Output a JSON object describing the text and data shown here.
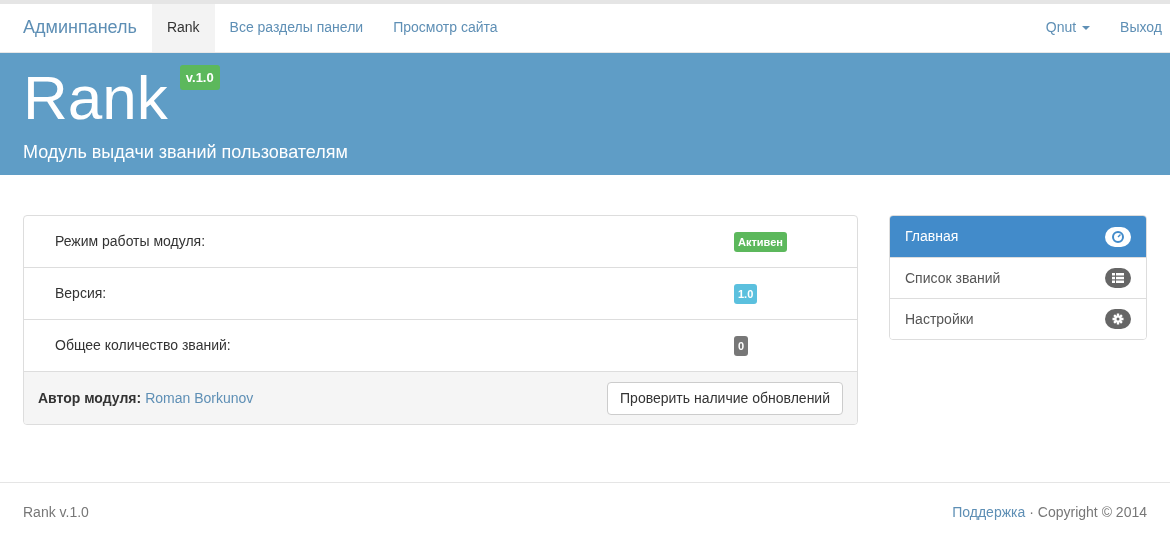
{
  "navbar": {
    "brand": "Админпанель",
    "items": [
      {
        "label": "Rank",
        "selected": true
      },
      {
        "label": "Все разделы панели",
        "selected": false
      },
      {
        "label": "Просмотр сайта",
        "selected": false
      }
    ],
    "user": "Qnut",
    "logout": "Выход"
  },
  "header": {
    "title": "Rank",
    "version": "v.1.0",
    "subtitle": "Модуль выдачи званий пользователям"
  },
  "info_rows": [
    {
      "label": "Режим работы модуля:",
      "badge": "Активен",
      "color": "#5cb85c"
    },
    {
      "label": "Версия:",
      "badge": "1.0",
      "color": "#5bc0de"
    },
    {
      "label": "Общее количество званий:",
      "badge": "0",
      "color": "#777777"
    }
  ],
  "panel_footer": {
    "author_label": "Автор модуля:",
    "author": "Roman Borkunov",
    "button": "Проверить наличие обновлений"
  },
  "sidebar": {
    "items": [
      {
        "label": "Главная",
        "kind": "dashboard",
        "selected": true
      },
      {
        "label": "Список званий",
        "kind": "list",
        "selected": false
      },
      {
        "label": "Настройки",
        "kind": "gear",
        "selected": false
      }
    ]
  },
  "footer": {
    "left": "Rank v.1.0",
    "link": "Поддержка",
    "copyright": "· Copyright © 2014"
  }
}
